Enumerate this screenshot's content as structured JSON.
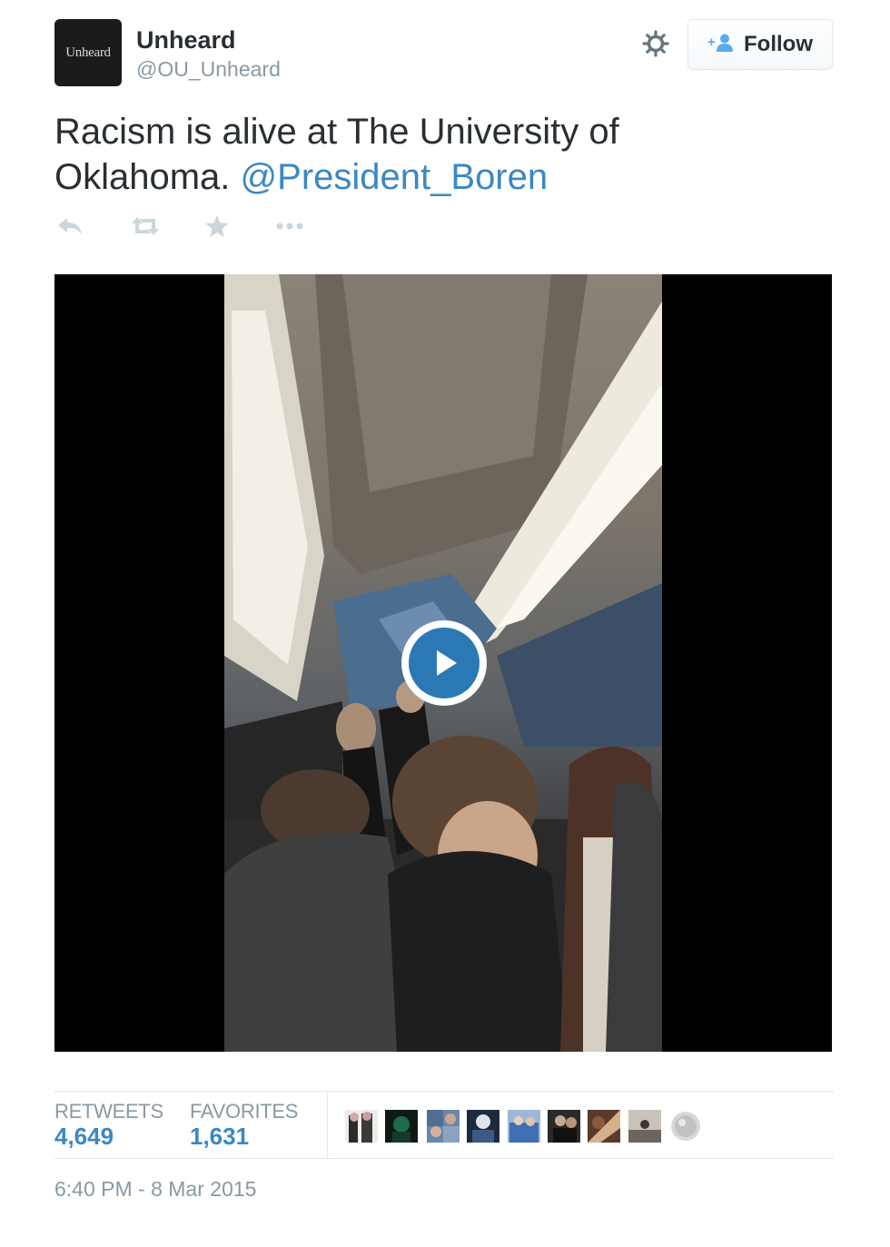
{
  "tweet": {
    "author": {
      "avatar_text": "Unheard",
      "name": "Unheard",
      "handle": "@OU_Unheard"
    },
    "follow_label": "Follow",
    "text": "Racism is alive at The University of Oklahoma.",
    "mention": "@President_Boren",
    "actions": [
      "reply-icon",
      "retweet-icon",
      "favorite-icon",
      "more-icon"
    ],
    "media": {
      "type": "video",
      "play_icon": "play-icon"
    },
    "stats": {
      "retweets_label": "RETWEETS",
      "retweets_count": "4,649",
      "favorites_label": "FAVORITES",
      "favorites_count": "1,631"
    },
    "timestamp": "6:40 PM - 8 Mar 2015"
  },
  "colors": {
    "link": "#3b88c3",
    "muted": "#8899a6",
    "text": "#292f33",
    "play_button": "#2a79b5"
  }
}
